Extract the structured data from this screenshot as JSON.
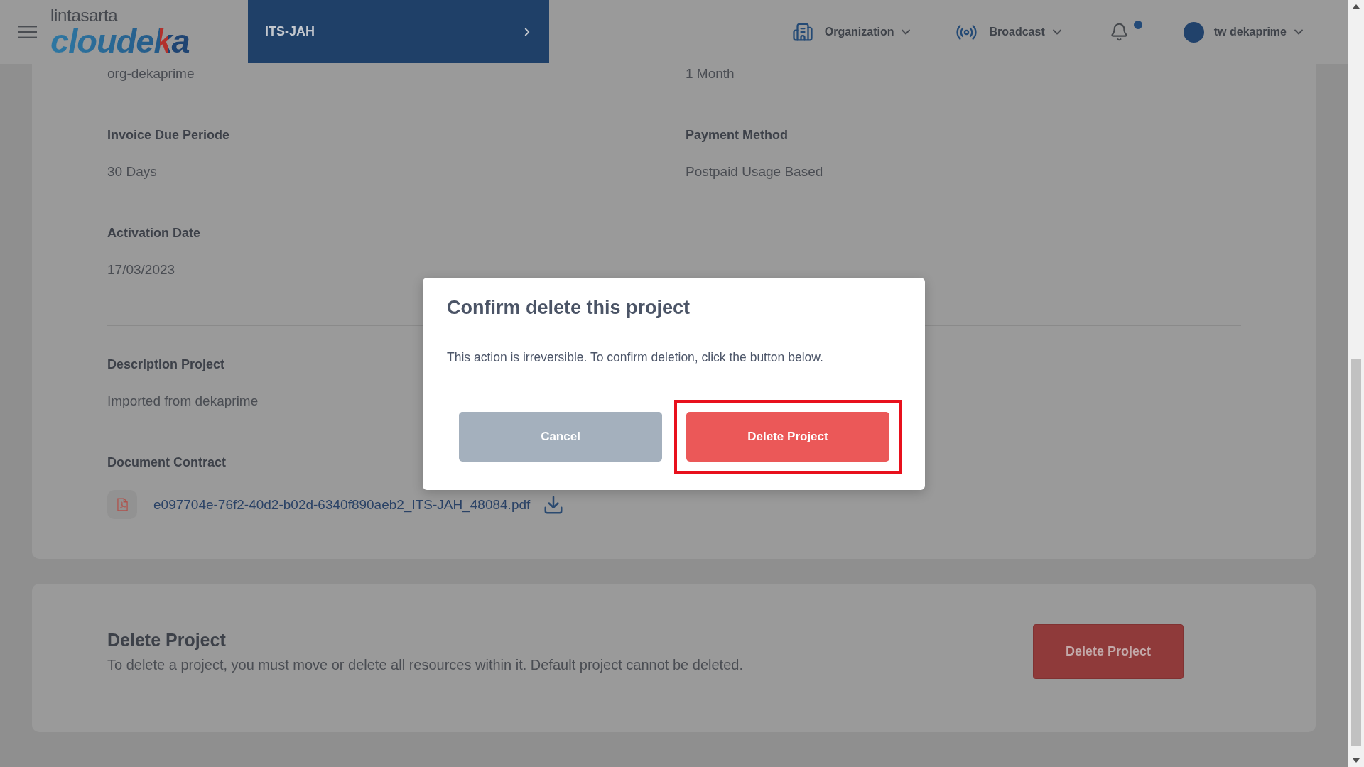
{
  "header": {
    "logo": {
      "company": "lintasarta",
      "product": "cloudeka"
    },
    "project_selector": {
      "label": "ITS-JAH"
    },
    "menus": [
      {
        "kind": "organization",
        "label": "Organization"
      },
      {
        "kind": "broadcast",
        "label": "Broadcast"
      }
    ],
    "notifications": {
      "unread": true
    },
    "user": {
      "name": "tw dekaprime"
    }
  },
  "details": {
    "top_values": [
      "org-dekaprime",
      "1 Month"
    ],
    "fields": [
      {
        "label": "Invoice Due Periode",
        "value": "30 Days"
      },
      {
        "label": "Payment Method",
        "value": "Postpaid Usage Based"
      },
      {
        "label": "Activation Date",
        "value": "17/03/2023"
      }
    ],
    "description": {
      "label": "Description Project",
      "value": "Imported from dekaprime"
    },
    "document": {
      "label": "Document Contract",
      "file_name": "e097704e-76f2-40d2-b02d-6340f890aeb2_ITS-JAH_48084.pdf"
    }
  },
  "delete_section": {
    "title": "Delete Project",
    "description": "To delete a project, you must move or delete all resources within it. Default project cannot be deleted.",
    "button": "Delete Project"
  },
  "dialog": {
    "title": "Confirm delete this project",
    "message": "This action is irreversible. To confirm deletion, click the button below.",
    "buttons": [
      {
        "kind": "cancel",
        "label": "Cancel",
        "highlighted": false
      },
      {
        "kind": "confirm",
        "label": "Delete Project",
        "highlighted": true
      }
    ]
  }
}
